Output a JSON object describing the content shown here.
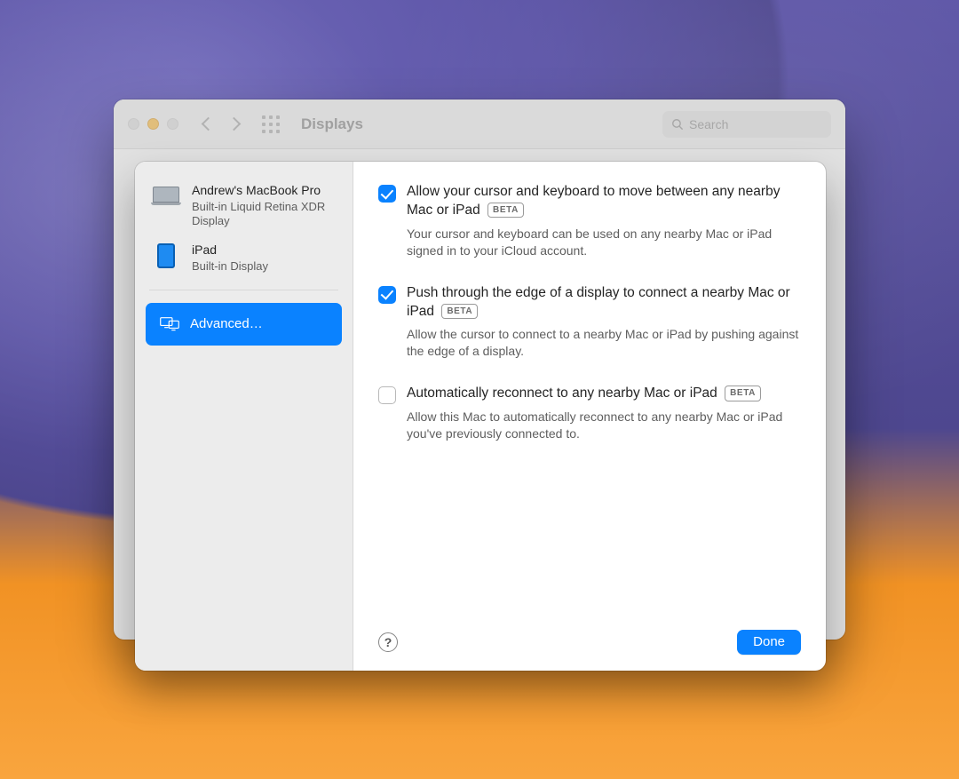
{
  "window": {
    "title": "Displays",
    "search_placeholder": "Search"
  },
  "sidebar": {
    "devices": [
      {
        "name": "Andrew's MacBook Pro",
        "subtitle": "Built-in Liquid Retina XDR Display",
        "type": "macbook"
      },
      {
        "name": "iPad",
        "subtitle": "Built-in Display",
        "type": "ipad"
      }
    ],
    "advanced_label": "Advanced…"
  },
  "options": [
    {
      "checked": true,
      "title": "Allow your cursor and keyboard to move between any nearby Mac or iPad",
      "badge": "BETA",
      "description": "Your cursor and keyboard can be used on any nearby Mac or iPad signed in to your iCloud account."
    },
    {
      "checked": true,
      "title": "Push through the edge of a display to connect a nearby Mac or iPad",
      "badge": "BETA",
      "description": "Allow the cursor to connect to a nearby Mac or iPad by pushing against the edge of a display."
    },
    {
      "checked": false,
      "title": "Automatically reconnect to any nearby Mac or iPad",
      "badge": "BETA",
      "description": "Allow this Mac to automatically reconnect to any nearby Mac or iPad you've previously connected to."
    }
  ],
  "footer": {
    "help": "?",
    "done": "Done"
  }
}
